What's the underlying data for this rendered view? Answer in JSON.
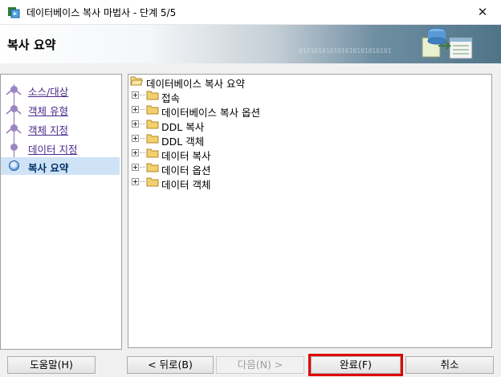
{
  "window": {
    "title": "데이터베이스 복사 마법사 - 단계 5/5",
    "close_glyph": "✕"
  },
  "header": {
    "title": "복사 요약",
    "binary_text": "010101010101010101010101"
  },
  "steps": [
    {
      "label": "소스/대상",
      "state": "done"
    },
    {
      "label": "객체 유형",
      "state": "done"
    },
    {
      "label": "객체 지정",
      "state": "done"
    },
    {
      "label": "데이터 지정",
      "state": "done"
    },
    {
      "label": "복사 요약",
      "state": "current"
    }
  ],
  "tree": {
    "root": {
      "label": "데이터베이스 복사 요약",
      "icon": "folder-open-icon"
    },
    "children": [
      {
        "label": "접속",
        "icon": "folder-icon"
      },
      {
        "label": "데이터베이스 복사 옵션",
        "icon": "folder-icon"
      },
      {
        "label": "DDL 복사",
        "icon": "folder-icon"
      },
      {
        "label": "DDL 객체",
        "icon": "folder-icon"
      },
      {
        "label": "데이터 복사",
        "icon": "folder-icon"
      },
      {
        "label": "데이터 옵션",
        "icon": "folder-icon"
      },
      {
        "label": "데이터 객체",
        "icon": "folder-icon"
      }
    ]
  },
  "buttons": {
    "help": "도움말(H)",
    "back": "< 뒤로(B)",
    "next": "다음(N) >",
    "finish": "완료(F)",
    "cancel": "취소"
  },
  "colors": {
    "step_link": "#4a2a8a",
    "current_step_bg": "#cfe3f7",
    "focus_highlight": "#e00000",
    "folder": "#f3cf6d"
  }
}
